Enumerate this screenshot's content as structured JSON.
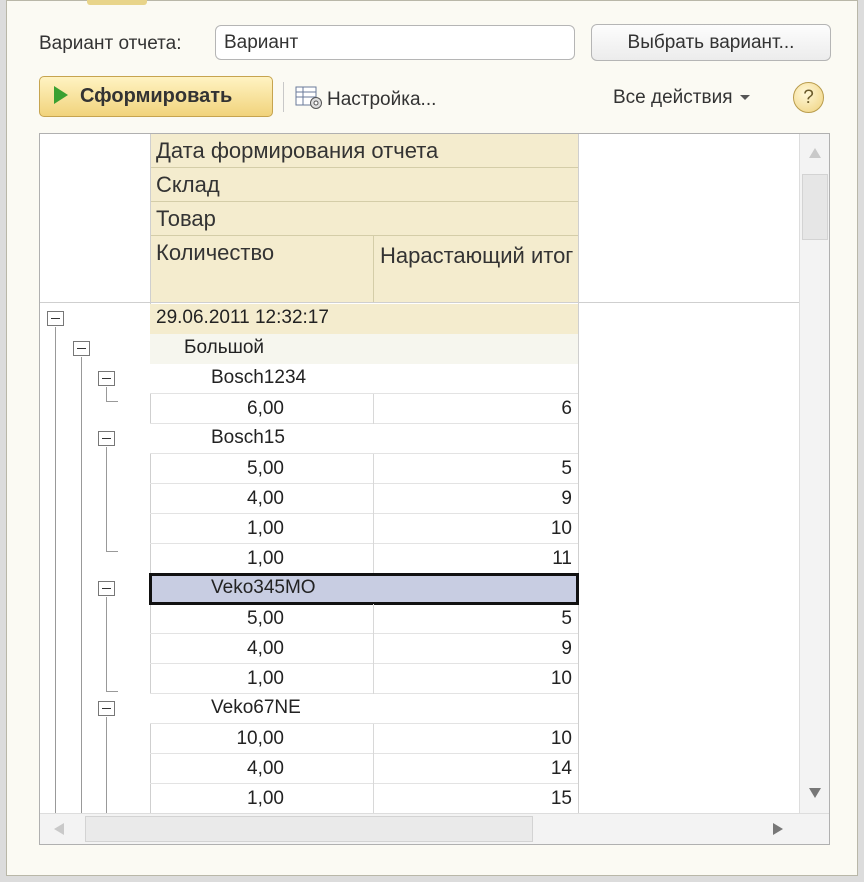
{
  "form": {
    "variant_label": "Вариант отчета:",
    "variant_value": "Вариант",
    "pick_variant_button": "Выбрать вариант...",
    "generate_button": "Сформировать",
    "settings_button": "Настройка...",
    "all_actions_menu": "Все действия",
    "help_button": "?"
  },
  "report": {
    "headers": {
      "date": "Дата формирования отчета",
      "warehouse": "Склад",
      "product": "Товар",
      "quantity": "Количество",
      "running_total": "Нарастающий итог"
    },
    "rows": [
      {
        "type": "date",
        "label": "29.06.2011 12:32:17"
      },
      {
        "type": "warehouse",
        "label": "Большой"
      },
      {
        "type": "product",
        "label": "Bosch1234"
      },
      {
        "type": "detail",
        "qty": "6,00",
        "total": "6"
      },
      {
        "type": "product",
        "label": "Bosch15"
      },
      {
        "type": "detail",
        "qty": "5,00",
        "total": "5"
      },
      {
        "type": "detail",
        "qty": "4,00",
        "total": "9"
      },
      {
        "type": "detail",
        "qty": "1,00",
        "total": "10"
      },
      {
        "type": "detail",
        "qty": "1,00",
        "total": "11"
      },
      {
        "type": "product",
        "label": "Veko345MO",
        "selected": true
      },
      {
        "type": "detail",
        "qty": "5,00",
        "total": "5"
      },
      {
        "type": "detail",
        "qty": "4,00",
        "total": "9"
      },
      {
        "type": "detail",
        "qty": "1,00",
        "total": "10"
      },
      {
        "type": "product",
        "label": "Veko67NE"
      },
      {
        "type": "detail",
        "qty": "10,00",
        "total": "10"
      },
      {
        "type": "detail",
        "qty": "4,00",
        "total": "14"
      },
      {
        "type": "detail",
        "qty": "1,00",
        "total": "15"
      }
    ]
  },
  "icons": {
    "play": "play-icon",
    "settings": "settings-grid-icon",
    "dropdown": "chevron-down-icon",
    "collapse": "minus-box-icon"
  },
  "colors": {
    "header_bg": "#f4ecce",
    "selection_bg": "#c8cde2",
    "play_green": "#3aa032",
    "button_gold": "#f1d37c"
  }
}
